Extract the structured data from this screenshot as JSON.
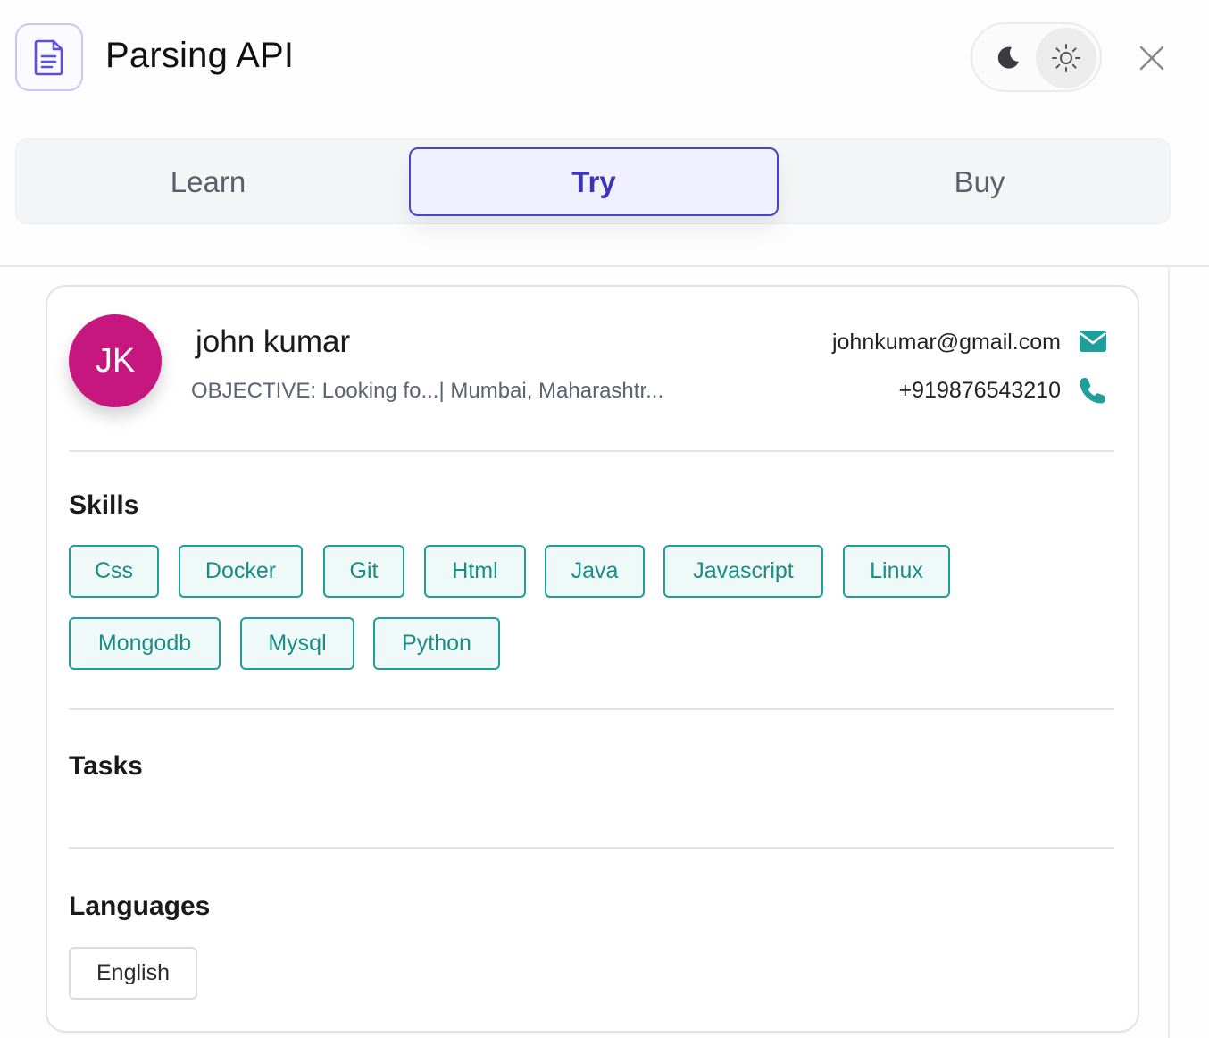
{
  "header": {
    "title": "Parsing API",
    "icons": {
      "app": "document-icon",
      "dark": "moon-icon",
      "light": "sun-icon",
      "close": "close-icon"
    }
  },
  "tabs": [
    {
      "label": "Learn",
      "active": false
    },
    {
      "label": "Try",
      "active": true
    },
    {
      "label": "Buy",
      "active": false
    }
  ],
  "profile": {
    "initials": "JK",
    "name": "john kumar",
    "subline": "OBJECTIVE: Looking fo...| Mumbai, Maharashtr...",
    "email": "johnkumar@gmail.com",
    "phone": "+919876543210",
    "avatar_color": "#c6177e"
  },
  "sections": {
    "skills_title": "Skills",
    "skills": [
      "Css",
      "Docker",
      "Git",
      "Html",
      "Java",
      "Javascript",
      "Linux",
      "Mongodb",
      "Mysql",
      "Python"
    ],
    "tasks_title": "Tasks",
    "languages_title": "Languages",
    "languages": [
      "English"
    ]
  },
  "colors": {
    "accent": "#4a44c8",
    "chip_border": "#1f9e9a",
    "chip_text": "#1a8d89",
    "icon_teal": "#1f9e9a"
  }
}
